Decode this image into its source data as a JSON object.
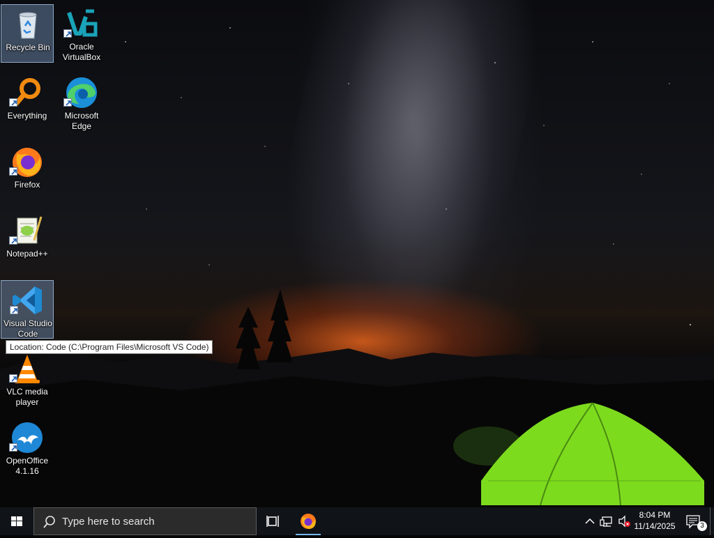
{
  "desktop": {
    "icons": [
      {
        "label": "Recycle Bin",
        "icon": "recycle-bin-icon",
        "selected": true
      },
      {
        "label": "Oracle VirtualBox",
        "icon": "virtualbox-icon"
      },
      {
        "label": "Everything",
        "icon": "everything-search-icon"
      },
      {
        "label": "Microsoft Edge",
        "icon": "edge-icon"
      },
      {
        "label": "Firefox",
        "icon": "firefox-icon"
      },
      {
        "label": "Notepad++",
        "icon": "notepadpp-icon"
      },
      {
        "label": "Visual Studio Code",
        "icon": "vscode-icon",
        "selected": true
      },
      {
        "label": "VLC media player",
        "icon": "vlc-icon"
      },
      {
        "label": "OpenOffice 4.1.16",
        "icon": "openoffice-icon"
      }
    ],
    "tooltip": "Location: Code (C:\\Program Files\\Microsoft VS Code)"
  },
  "taskbar": {
    "search_placeholder": "Type here to search",
    "pinned": [
      {
        "name": "Firefox",
        "icon": "firefox-icon",
        "active": true
      }
    ],
    "clock": {
      "time": "8:04 PM",
      "date": "11/14/2025"
    },
    "notification_count": "3"
  },
  "colors": {
    "taskbar": "#101318",
    "search_box": "#2b2b2b",
    "selection": "#7896be",
    "accent": "#76b9ed"
  }
}
